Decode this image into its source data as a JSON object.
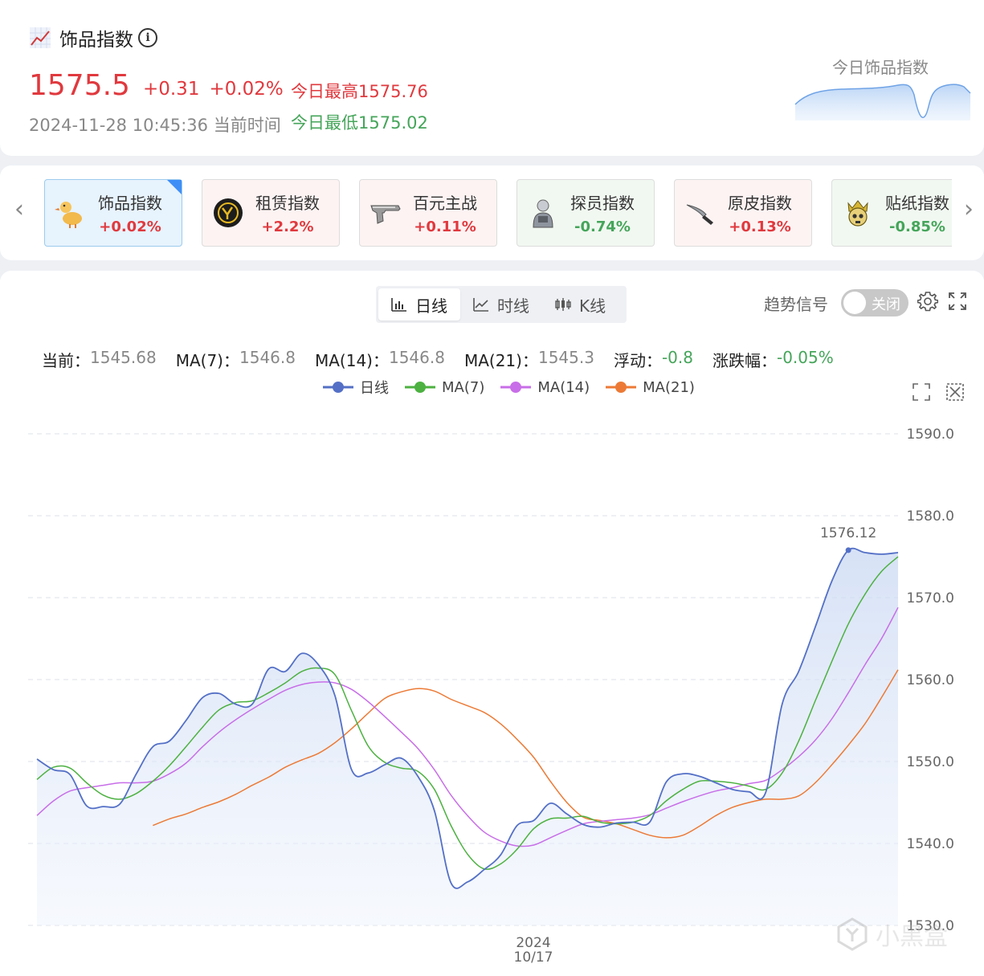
{
  "header": {
    "title": "饰品指数",
    "price": "1575.5",
    "change": "+0.31",
    "change_pct": "+0.02%",
    "time": "2024-11-28 10:45:36 当前时间",
    "today_high": "今日最高1575.76",
    "today_low": "今日最低1575.02",
    "mini_chart_title": "今日饰品指数"
  },
  "categories": [
    {
      "name": "饰品指数",
      "change": "+0.02%",
      "direction": "up",
      "active": true,
      "icon": "duck-icon"
    },
    {
      "name": "租赁指数",
      "change": "+2.2%",
      "direction": "up",
      "active": false,
      "icon": "rental-logo-icon"
    },
    {
      "name": "百元主战",
      "change": "+0.11%",
      "direction": "up",
      "active": false,
      "icon": "pistol-icon"
    },
    {
      "name": "探员指数",
      "change": "-0.74%",
      "direction": "down",
      "active": false,
      "icon": "agent-icon"
    },
    {
      "name": "原皮指数",
      "change": "+0.13%",
      "direction": "up",
      "active": false,
      "icon": "knife-icon"
    },
    {
      "name": "贴纸指数",
      "change": "-0.85%",
      "direction": "down",
      "active": false,
      "icon": "skull-crown-icon"
    }
  ],
  "tabs": {
    "daily": "日线",
    "time": "时线",
    "kline": "K线"
  },
  "controls": {
    "signal_label": "趋势信号",
    "toggle_text": "关闭"
  },
  "stats": {
    "current_label": "当前：",
    "current_value": "1545.68",
    "ma7_label": "MA(7)：",
    "ma7_value": "1546.8",
    "ma14_label": "MA(14)：",
    "ma14_value": "1546.8",
    "ma21_label": "MA(21)：",
    "ma21_value": "1545.3",
    "float_label": "浮动：",
    "float_value": "-0.8",
    "pct_label": "涨跌幅：",
    "pct_value": "-0.05%"
  },
  "watermark": "小黑盒",
  "colors": {
    "up": "#e0393e",
    "down": "#45a55a",
    "daily": "#5470c6",
    "ma7": "#4cb140",
    "ma14": "#c86ee8",
    "ma21": "#ec7a36"
  },
  "chart_data": {
    "type": "line",
    "ylim": [
      1530,
      1590
    ],
    "yticks": [
      "1590.0",
      "1580.0",
      "1570.0",
      "1560.0",
      "1550.0",
      "1540.0",
      "1530.0"
    ],
    "x_label_year": "2024",
    "x_label_date": "10/17",
    "max_label": "1576.12",
    "series": [
      {
        "name": "日线",
        "color": "#5470c6",
        "values": [
          1550.3,
          1549.0,
          1548.4,
          1544.6,
          1544.5,
          1544.8,
          1548.5,
          1551.8,
          1552.5,
          1555.0,
          1557.8,
          1558.3,
          1557.0,
          1557.0,
          1561.3,
          1561.0,
          1563.2,
          1561.8,
          1558.0,
          1549.0,
          1548.6,
          1549.6,
          1550.4,
          1548.2,
          1544.0,
          1535.2,
          1535.3,
          1536.8,
          1538.6,
          1542.2,
          1542.8,
          1544.9,
          1543.6,
          1542.3,
          1542.0,
          1542.5,
          1542.6,
          1542.6,
          1547.5,
          1548.5,
          1548.2,
          1547.4,
          1546.6,
          1546.3,
          1546.2,
          1557.0,
          1561.0,
          1566.4,
          1572.0,
          1575.8,
          1575.5,
          1575.3,
          1575.5
        ]
      },
      {
        "name": "MA(7)",
        "color": "#4cb140",
        "values": [
          1547.8,
          1549.3,
          1549.2,
          1547.4,
          1545.9,
          1545.4,
          1546.1,
          1547.6,
          1549.5,
          1551.8,
          1554.2,
          1556.3,
          1557.2,
          1557.4,
          1558.4,
          1559.6,
          1561.0,
          1561.4,
          1560.6,
          1556.2,
          1551.9,
          1549.9,
          1549.2,
          1548.8,
          1546.6,
          1542.2,
          1538.7,
          1536.9,
          1537.5,
          1539.3,
          1541.8,
          1543.0,
          1543.1,
          1543.3,
          1542.6,
          1542.4,
          1542.6,
          1543.4,
          1545.2,
          1546.6,
          1547.6,
          1547.6,
          1547.4,
          1547.0,
          1546.6,
          1548.6,
          1552.5,
          1557.4,
          1562.2,
          1566.8,
          1570.4,
          1573.2,
          1575.0
        ]
      },
      {
        "name": "MA(14)",
        "color": "#c86ee8",
        "values": [
          1543.4,
          1545.2,
          1546.4,
          1546.8,
          1547.1,
          1547.4,
          1547.4,
          1547.6,
          1548.5,
          1549.8,
          1551.8,
          1553.6,
          1555.1,
          1556.4,
          1557.6,
          1558.7,
          1559.4,
          1559.7,
          1559.6,
          1558.8,
          1557.3,
          1555.5,
          1553.6,
          1551.6,
          1549.0,
          1545.9,
          1543.4,
          1541.4,
          1540.3,
          1539.7,
          1539.8,
          1540.7,
          1541.6,
          1542.4,
          1542.7,
          1542.9,
          1543.1,
          1543.5,
          1544.3,
          1545.1,
          1545.8,
          1546.4,
          1546.8,
          1547.3,
          1547.7,
          1549.0,
          1550.6,
          1552.6,
          1555.2,
          1558.4,
          1561.8,
          1565.0,
          1568.8
        ]
      },
      {
        "name": "MA(21)",
        "color": "#ec7a36",
        "values": [
          1542.2,
          1543.0,
          1543.6,
          1544.4,
          1545.1,
          1546.0,
          1547.1,
          1548.1,
          1549.3,
          1550.2,
          1551.0,
          1552.3,
          1554.0,
          1555.9,
          1557.7,
          1558.5,
          1558.9,
          1558.6,
          1557.6,
          1556.8,
          1556.0,
          1554.6,
          1552.7,
          1550.5,
          1547.6,
          1545.0,
          1543.2,
          1542.8,
          1542.4,
          1541.7,
          1541.0,
          1540.7,
          1541.0,
          1542.1,
          1543.4,
          1544.4,
          1545.0,
          1545.4,
          1545.4,
          1545.8,
          1547.4,
          1549.6,
          1552.0,
          1554.6,
          1557.8,
          1561.2
        ]
      }
    ]
  }
}
